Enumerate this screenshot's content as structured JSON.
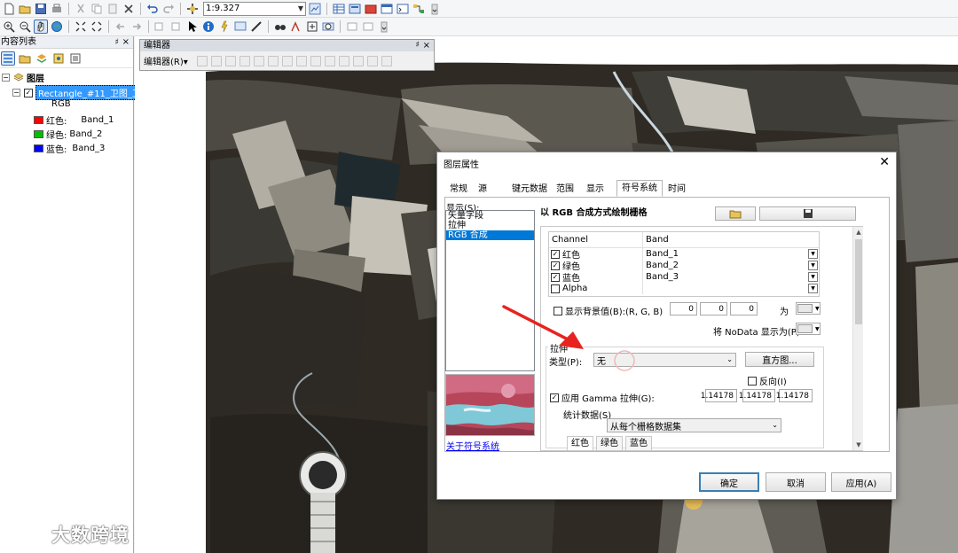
{
  "toolbar": {
    "scale": "1:9.327"
  },
  "toc": {
    "title": "内容列表",
    "pin": "♯",
    "close": "×",
    "group_label": "图层",
    "layer_name": "Rectangle_#11_卫图_卫",
    "render_label": "RGB",
    "bands": [
      {
        "label": "红色:",
        "band": "Band_1",
        "color": "#ff0000"
      },
      {
        "label": "绿色:",
        "band": "Band_2",
        "color": "#00c000"
      },
      {
        "label": "蓝色:",
        "band": "Band_3",
        "color": "#0000ff"
      }
    ]
  },
  "editor": {
    "title": "编辑器",
    "menu": "编辑器(R)▾",
    "pin": "♯",
    "close": "×"
  },
  "dialog": {
    "title": "图层属性",
    "close": "✕",
    "tabs": [
      "常规",
      "源",
      "键元数据",
      "范围",
      "显示",
      "符号系统",
      "时间"
    ],
    "active_tab": "符号系统",
    "show_label": "显示(S):",
    "show_items": [
      "矢量字段",
      "拉伸",
      "RGB 合成"
    ],
    "selected_show": "RGB 合成",
    "about_link": "关于符号系统",
    "heading": "以 RGB 合成方式绘制栅格",
    "channel_header": "Channel",
    "band_header": "Band",
    "channels": [
      {
        "name": "红色",
        "band": "Band_1",
        "checked": true
      },
      {
        "name": "绿色",
        "band": "Band_2",
        "checked": true
      },
      {
        "name": "蓝色",
        "band": "Band_3",
        "checked": true
      },
      {
        "name": "Alpha",
        "band": "",
        "checked": false
      }
    ],
    "bg_label": "显示背景值(B):(R, G, B)",
    "bg_values": [
      "0",
      "0",
      "0"
    ],
    "as_label": "为",
    "nodata_label": "将 NoData 显示为(P)",
    "stretch_group": "拉伸",
    "type_label": "类型(P):",
    "type_value": "无",
    "histogram_btn": "直方图...",
    "invert_label": "反向(I)",
    "gamma_label": "应用 Gamma 拉伸(G):",
    "gamma_values": [
      "1.14178",
      "1.14178",
      "1.14178"
    ],
    "stats_label": "统计数据(S)",
    "stats_value": "从每个栅格数据集",
    "stat_tabs": [
      "红色",
      "绿色",
      "蓝色"
    ],
    "ok": "确定",
    "cancel": "取消",
    "apply": "应用(A)"
  },
  "watermark": {
    "text": "大数跨境"
  },
  "colors": {
    "accent": "#0078d7",
    "arrow": "#e8231f"
  }
}
